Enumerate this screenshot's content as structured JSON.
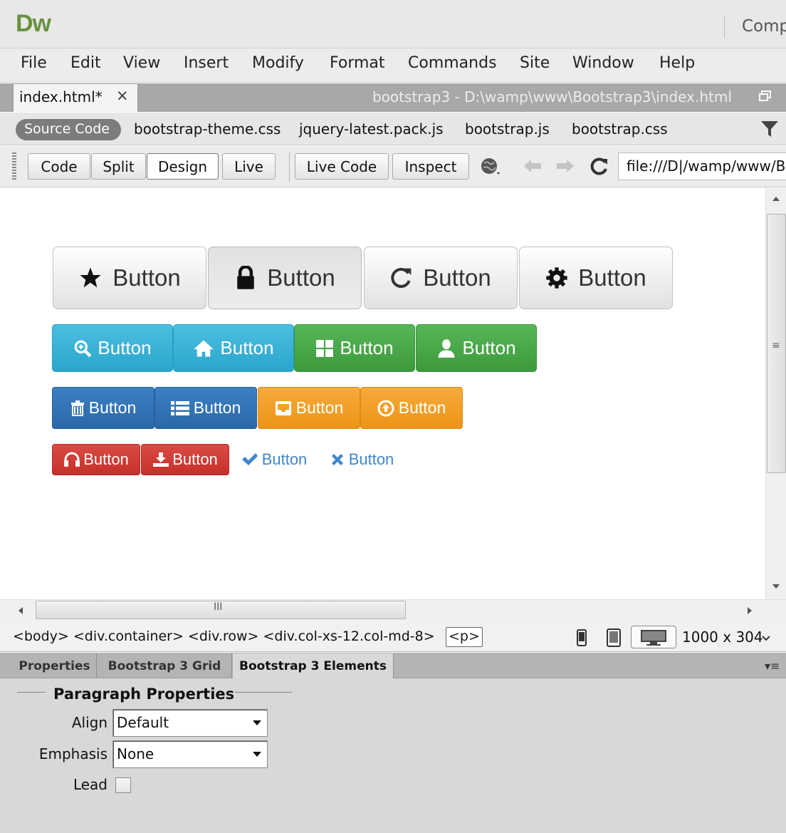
{
  "app": {
    "logo": "Dw",
    "workspace": "Comp"
  },
  "menu": [
    "File",
    "Edit",
    "View",
    "Insert",
    "Modify",
    "Format",
    "Commands",
    "Site",
    "Window",
    "Help"
  ],
  "doc_tab": {
    "label": "index.html*",
    "close": "×",
    "path": "bootstrap3 - D:\\wamp\\www\\Bootstrap3\\index.html"
  },
  "related_files": {
    "source": "Source Code",
    "files": [
      "bootstrap-theme.css",
      "jquery-latest.pack.js",
      "bootstrap.js",
      "bootstrap.css"
    ]
  },
  "toolbar": {
    "views": [
      "Code",
      "Split",
      "Design",
      "Live"
    ],
    "active_view": "Design",
    "live_code": "Live Code",
    "inspect": "Inspect",
    "url": "file:///D|/wamp/www/Bo"
  },
  "design": {
    "row1": [
      {
        "icon": "star-icon",
        "label": "Button"
      },
      {
        "icon": "lock-icon",
        "label": "Button"
      },
      {
        "icon": "refresh-icon",
        "label": "Button"
      },
      {
        "icon": "gear-icon",
        "label": "Button"
      }
    ],
    "row2": [
      {
        "icon": "zoom-in-icon",
        "label": "Button",
        "style": "info"
      },
      {
        "icon": "home-icon",
        "label": "Button",
        "style": "info"
      },
      {
        "icon": "grid-icon",
        "label": "Button",
        "style": "success"
      },
      {
        "icon": "user-icon",
        "label": "Button",
        "style": "success"
      }
    ],
    "row3": [
      {
        "icon": "trash-icon",
        "label": "Button",
        "style": "primary"
      },
      {
        "icon": "list-icon",
        "label": "Button",
        "style": "primary"
      },
      {
        "icon": "inbox-icon",
        "label": "Button",
        "style": "warning"
      },
      {
        "icon": "upload-circle-icon",
        "label": "Button",
        "style": "warning"
      }
    ],
    "row4": [
      {
        "icon": "headphones-icon",
        "label": "Button",
        "style": "danger"
      },
      {
        "icon": "download-icon",
        "label": "Button",
        "style": "danger"
      },
      {
        "icon": "check-icon",
        "label": "Button",
        "style": "link"
      },
      {
        "icon": "remove-icon",
        "label": "Button",
        "style": "link"
      }
    ]
  },
  "status": {
    "tag_selector": "<body> <div.container> <div.row> <div.col-xs-12.col-md-8>",
    "current_tag": "<p>",
    "viewport_size": "1000 x 304"
  },
  "panel": {
    "tabs": [
      "Properties",
      "Bootstrap 3 Grid",
      "Bootstrap 3 Elements"
    ],
    "active_tab": "Bootstrap 3 Elements",
    "section_title": "Paragraph Properties",
    "align_label": "Align",
    "align_value": "Default",
    "emphasis_label": "Emphasis",
    "emphasis_value": "None",
    "lead_label": "Lead",
    "lead_checked": false
  },
  "colors": {
    "info": "#31b0d5",
    "success": "#449d44",
    "primary": "#337ab7",
    "warning": "#f0ad4e",
    "danger": "#d9534f",
    "link": "#3f87cc",
    "dw_green": "#68923f"
  }
}
